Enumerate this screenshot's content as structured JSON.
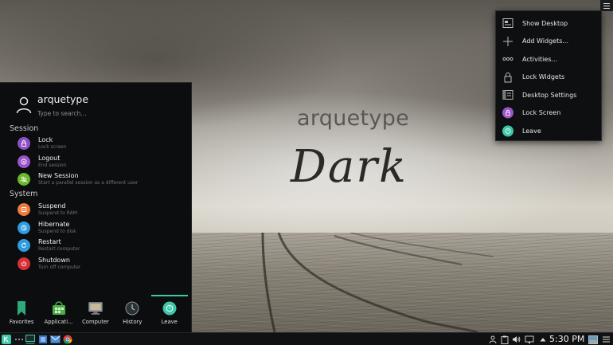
{
  "wallpaper": {
    "title": "arquetype",
    "subtitle": "Dark"
  },
  "desktop_menu": {
    "items": [
      {
        "label": "Show Desktop",
        "icon": "show-desktop-icon"
      },
      {
        "label": "Add Widgets...",
        "icon": "plus-icon"
      },
      {
        "label": "Activities...",
        "icon": "activities-icon"
      },
      {
        "label": "Lock Widgets",
        "icon": "lock-icon"
      },
      {
        "label": "Desktop Settings",
        "icon": "desktop-settings-icon"
      },
      {
        "label": "Lock Screen",
        "icon": "lock-screen-icon"
      },
      {
        "label": "Leave",
        "icon": "leave-icon"
      }
    ]
  },
  "launcher": {
    "user_name": "arquetype",
    "search_placeholder": "Type to search...",
    "sections": {
      "session": "Session",
      "system": "System"
    },
    "items": [
      {
        "title": "Lock",
        "subtitle": "Lock screen",
        "icon": "lock-icon",
        "color": "#8e4fc4"
      },
      {
        "title": "Logout",
        "subtitle": "End session",
        "icon": "logout-icon",
        "color": "#9b55c8"
      },
      {
        "title": "New Session",
        "subtitle": "Start a parallel session as a different user",
        "icon": "users-icon",
        "color": "#6ab82a"
      },
      {
        "title": "Suspend",
        "subtitle": "Suspend to RAM",
        "icon": "suspend-icon",
        "color": "#f07a3a"
      },
      {
        "title": "Hibernate",
        "subtitle": "Suspend to disk",
        "icon": "hibernate-icon",
        "color": "#2f9be0"
      },
      {
        "title": "Restart",
        "subtitle": "Restart computer",
        "icon": "restart-icon",
        "color": "#2f9be0"
      },
      {
        "title": "Shutdown",
        "subtitle": "Turn off computer",
        "icon": "power-icon",
        "color": "#d93036"
      }
    ],
    "tabs": [
      {
        "label": "Favorites",
        "icon": "bookmark-icon",
        "active": false
      },
      {
        "label": "Applicati...",
        "icon": "applications-icon",
        "active": false
      },
      {
        "label": "Computer",
        "icon": "computer-icon",
        "active": false
      },
      {
        "label": "History",
        "icon": "history-icon",
        "active": false
      },
      {
        "label": "Leave",
        "icon": "leave-icon",
        "active": true
      }
    ]
  },
  "taskbar": {
    "clock": "5:30 PM",
    "accent": "#3ec6a8"
  }
}
